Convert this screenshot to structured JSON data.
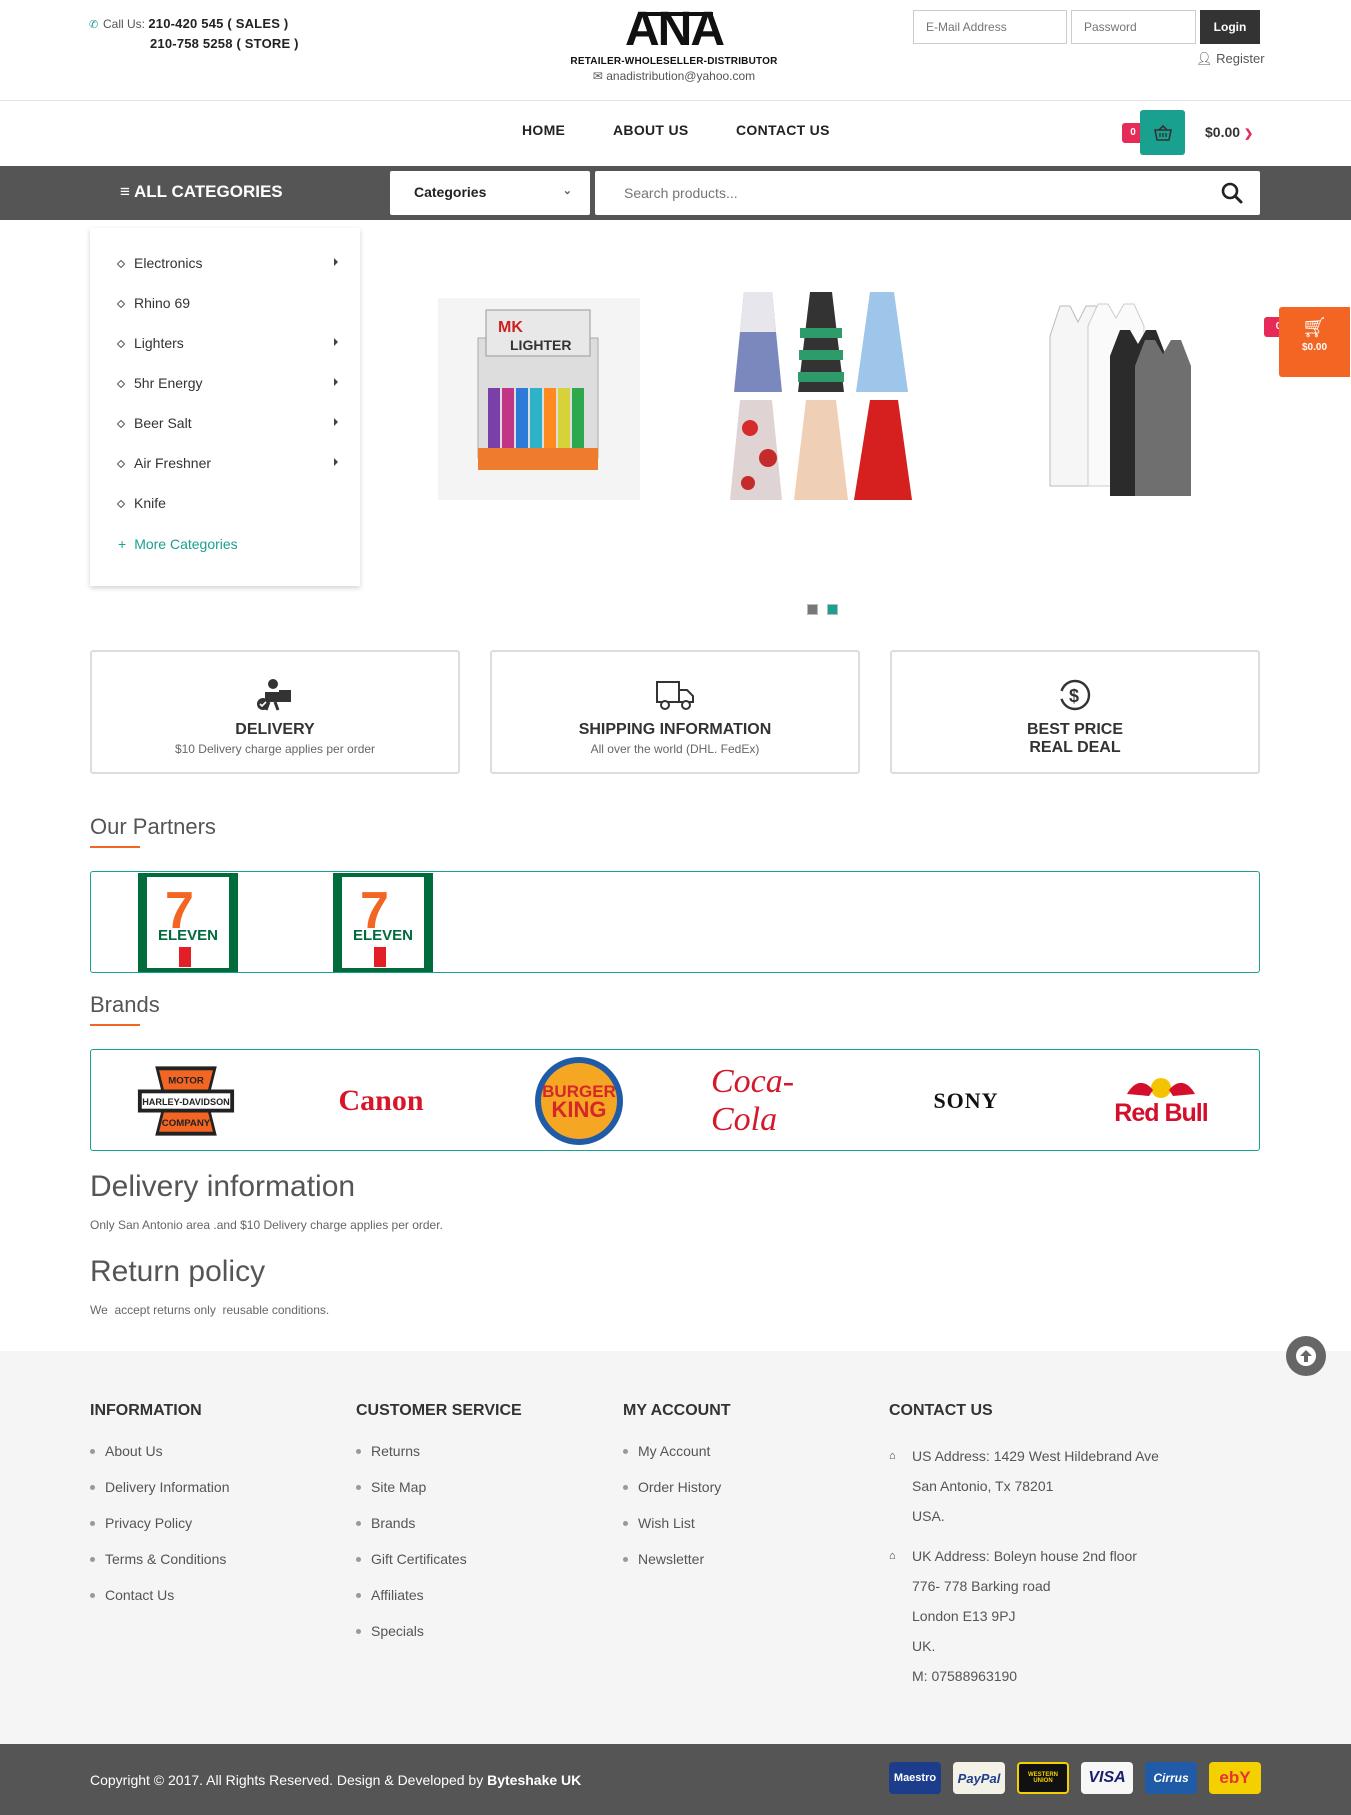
{
  "header": {
    "call_label": "Call Us:",
    "phone_sales": "210-420 545 ( SALES )",
    "phone_store": "210-758 5258 ( STORE )",
    "logo_text": "ANA",
    "tagline": "RETAILER-WHOLESELLER-DISTRIBUTOR",
    "email": "anadistribution@yahoo.com",
    "email_placeholder": "E-Mail Address",
    "password_placeholder": "Password",
    "login_label": "Login",
    "register_label": "Register"
  },
  "nav": {
    "items": [
      "HOME",
      "ABOUT US",
      "CONTACT US"
    ],
    "cart_count": "0",
    "cart_total": "$0.00"
  },
  "catbar": {
    "all_categories": "ALL CATEGORIES",
    "select_value": "Categories",
    "search_placeholder": "Search products..."
  },
  "sidebar": {
    "items": [
      "Electronics",
      "Rhino 69",
      "Lighters",
      "5hr Energy",
      "Beer Salt",
      "Air Freshner",
      "Knife"
    ],
    "more": "More Categories"
  },
  "floating_cart": {
    "count": "0",
    "total": "$0.00"
  },
  "features": [
    {
      "title": "DELIVERY",
      "subtitle": "$10 Delivery charge applies per order"
    },
    {
      "title": "SHIPPING INFORMATION",
      "subtitle": "All over the world (DHL. FedEx)"
    },
    {
      "title": "BEST PRICE",
      "subtitle": "REAL DEAL"
    }
  ],
  "partners": {
    "title": "Our Partners",
    "logo_text": "ELEVEN"
  },
  "brands": {
    "title": "Brands",
    "harley": [
      "MOTOR",
      "HARLEY-DAVIDSON",
      "COMPANY"
    ],
    "canon": "Canon",
    "bk": [
      "BURGER",
      "KING"
    ],
    "coke": "Coca-Cola",
    "sony": "SONY",
    "redbull": "Red Bull"
  },
  "delivery": {
    "title": "Delivery information",
    "text": "Only San Antonio area .and $10 Delivery charge applies per order."
  },
  "returns": {
    "title": "Return policy",
    "text": "We  accept returns only  reusable conditions."
  },
  "footer": {
    "information": {
      "title": "INFORMATION",
      "links": [
        "About Us",
        "Delivery Information",
        "Privacy Policy",
        "Terms & Conditions",
        "Contact Us"
      ]
    },
    "service": {
      "title": "CUSTOMER SERVICE",
      "links": [
        "Returns",
        "Site Map",
        "Brands",
        "Gift Certificates",
        "Affiliates",
        "Specials"
      ]
    },
    "account": {
      "title": "MY ACCOUNT",
      "links": [
        "My Account",
        "Order History",
        "Wish List",
        "Newsletter"
      ]
    },
    "contact": {
      "title": "CONTACT US",
      "us_lines": [
        "US Address: 1429 West Hildebrand Ave",
        "San Antonio, Tx 78201",
        "USA."
      ],
      "uk_lines": [
        "UK Address: Boleyn house 2nd floor",
        "776- 778 Barking road",
        "London E13 9PJ",
        "UK.",
        "M: 07588963190"
      ]
    }
  },
  "bottom": {
    "copyright": "Copyright © 2017. All Rights Reserved. Design & Developed by",
    "developer": "Byteshake UK",
    "payments": [
      "Maestro",
      "PayPal",
      "WESTERN UNION",
      "VISA",
      "Cirrus",
      "ebY"
    ]
  }
}
